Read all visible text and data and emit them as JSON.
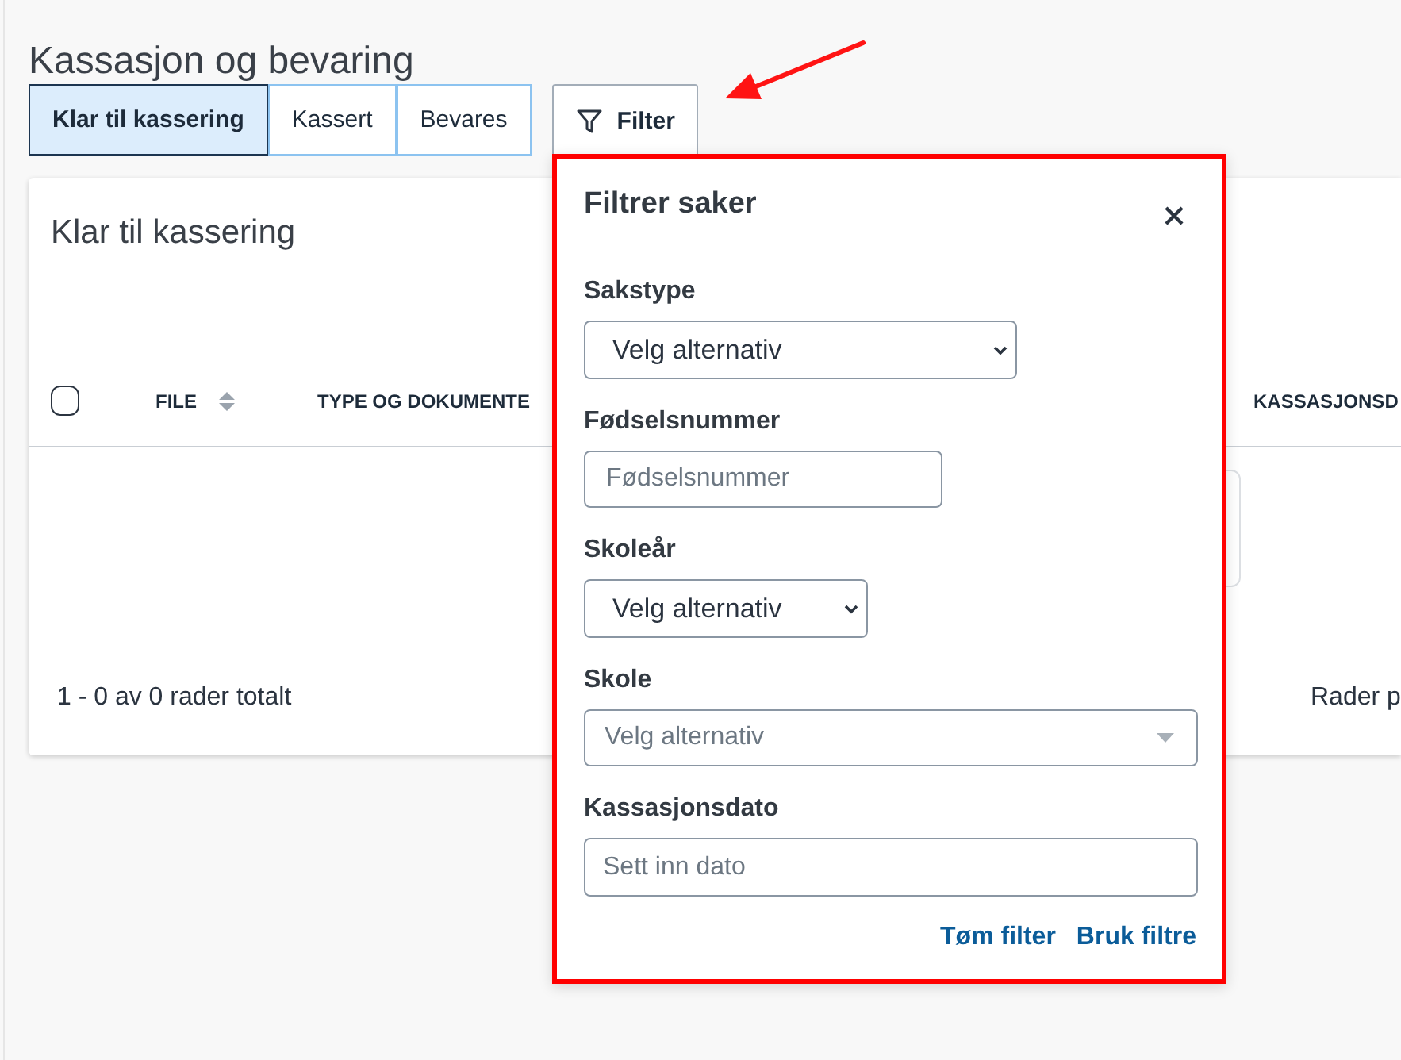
{
  "page": {
    "title": "Kassasjon og bevaring"
  },
  "tabs": [
    {
      "label": "Klar til kassering",
      "selected": true
    },
    {
      "label": "Kassert",
      "selected": false
    },
    {
      "label": "Bevares",
      "selected": false
    }
  ],
  "filter_button": {
    "label": "Filter"
  },
  "table_card": {
    "title": "Klar til kassering",
    "select_all": {
      "checked": false
    },
    "columns": [
      {
        "label": "FILE",
        "sortable": true
      },
      {
        "label": "TYPE OG DOKUMENTE",
        "sortable": false
      },
      {
        "label": "KASSASJONSD",
        "sortable": false
      }
    ],
    "footer": {
      "summary": "1 - 0 av 0 rader totalt",
      "rows_per_page_label": "Rader p"
    }
  },
  "filter_panel": {
    "title": "Filtrer saker",
    "fields": [
      {
        "kind": "select",
        "label": "Sakstype",
        "value": "Velg alternativ"
      },
      {
        "kind": "text",
        "label": "Fødselsnummer",
        "placeholder": "Fødselsnummer"
      },
      {
        "kind": "select",
        "label": "Skoleår",
        "value": "Velg alternativ"
      },
      {
        "kind": "combobox",
        "label": "Skole",
        "placeholder": "Velg alternativ"
      },
      {
        "kind": "date",
        "label": "Kassasjonsdato",
        "placeholder": "Sett inn dato"
      }
    ],
    "actions": [
      "Tøm filter",
      "Bruk filtre"
    ]
  }
}
